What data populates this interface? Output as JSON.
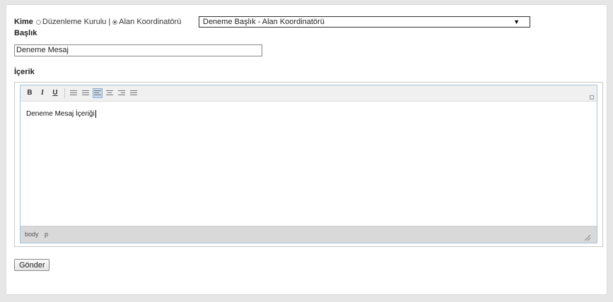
{
  "form": {
    "kime_label": "Kime",
    "options": [
      {
        "label": "Düzenleme Kurulu",
        "checked": false
      },
      {
        "label": "Alan Koordinatörü",
        "checked": true
      }
    ],
    "separator": "|",
    "recipient_select_value": "Deneme Başlık - Alan Koordinatörü",
    "select_arrow": "▼",
    "baslik_label": "Başlık",
    "baslik_value": "Deneme Mesaj",
    "icerik_label": "İçerik",
    "submit_label": "Gönder"
  },
  "editor": {
    "toolbar": {
      "bold": "B",
      "italic": "I",
      "underline": "U"
    },
    "content": "Deneme Mesaj İçeriği",
    "status_path": [
      "body",
      "p"
    ]
  },
  "colors": {
    "page_bg": "#e6e6e6",
    "panel_bg": "#ffffff",
    "editor_border": "#a9c3e0",
    "statusbar_bg": "#d9d9d9"
  }
}
